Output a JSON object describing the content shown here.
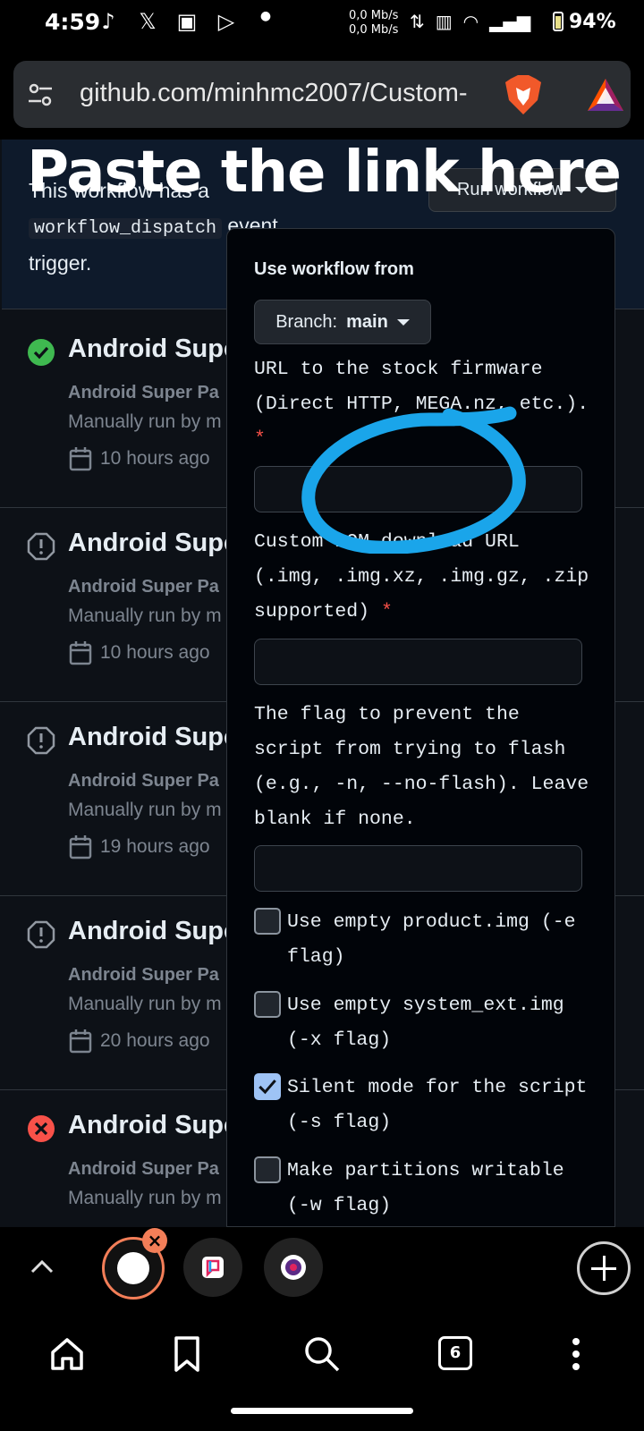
{
  "status_bar": {
    "time": "4:59",
    "net_up": "0,0 Mb/s",
    "net_down": "0,0 Mb/s",
    "battery": "94%"
  },
  "browser": {
    "url": "github.com/minhmc2007/Custom-",
    "tab_count": "6"
  },
  "overlay": {
    "text": "Paste the link here"
  },
  "banner": {
    "text_before": "This workflow has a",
    "code": "workflow_dispatch",
    "text_after": " event trigger.",
    "run_button": "Run workflow"
  },
  "runs": [
    {
      "status": "success",
      "title": "Android Supe",
      "subtitle": "Android Super Pa",
      "by": "Manually run by m",
      "time": "10 hours ago"
    },
    {
      "status": "warning",
      "title": "Android Supe",
      "subtitle": "Android Super Pa",
      "by": "Manually run by m",
      "time": "10 hours ago"
    },
    {
      "status": "warning",
      "title": "Android Supe",
      "subtitle": "Android Super Pa",
      "by": "Manually run by m",
      "time": "19 hours ago"
    },
    {
      "status": "warning",
      "title": "Android Supe",
      "subtitle": "Android Super Pa",
      "by": "Manually run by m",
      "time": "20 hours ago"
    },
    {
      "status": "failure",
      "title": "Android Supe",
      "subtitle": "Android Super Pa",
      "by": "Manually run by m",
      "time": ""
    }
  ],
  "panel": {
    "title": "Use workflow from",
    "branch_label": "Branch:",
    "branch_value": "main",
    "field1_label": "URL to the stock firmware (Direct HTTP, MEGA.nz, etc.).",
    "field1_value": "",
    "field2_label": "Custom ROM download URL (.img, .img.xz, .img.gz, .zip supported)",
    "field2_value": "",
    "field3_label": "The flag to prevent the script from trying to flash (e.g., -n, --no-flash). Leave blank if none.",
    "field3_value": "",
    "required_mark": "*",
    "checkboxes": [
      {
        "label": "Use empty product.img (-e flag)",
        "checked": false
      },
      {
        "label": "Use empty system_ext.img (-x flag)",
        "checked": false
      },
      {
        "label": "Silent mode for the script (-s flag)",
        "checked": true
      },
      {
        "label": "Make partitions writable (-w flag)",
        "checked": false
      }
    ]
  },
  "colors": {
    "accent_scribble": "#1aa5ea",
    "success": "#3fb950",
    "failure": "#f85149",
    "brave_orange": "#f37e58"
  }
}
